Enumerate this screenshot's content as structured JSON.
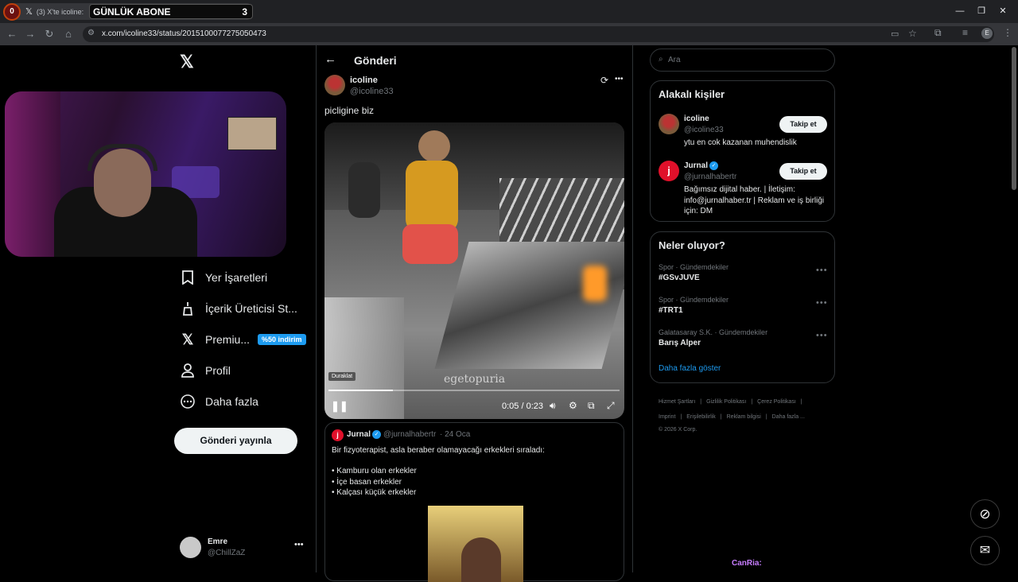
{
  "browser": {
    "tab_title": "(3) X'te icoline: \"pic",
    "overlay_counter": "0",
    "overlay_label": "GÜNLÜK ABONE",
    "overlay_count": "3",
    "url": "x.com/icoline33/status/2015100077275050473",
    "profile_initial": "E"
  },
  "sidebar": {
    "items": [
      {
        "label": "Yer İşaretleri"
      },
      {
        "label": "İçerik Üreticisi St..."
      },
      {
        "label": "Premiu...",
        "badge": "%50 indirim"
      },
      {
        "label": "Profil"
      },
      {
        "label": "Daha fazla"
      }
    ],
    "post_button": "Gönderi yayınla",
    "account": {
      "name": "Emre",
      "handle": "@ChillZaZ"
    }
  },
  "post": {
    "header_title": "Gönderi",
    "author_name": "icoline",
    "author_handle": "@icoline33",
    "text": "picligine biz",
    "video": {
      "watermark": "egetopuria",
      "paused_label": "Duraklat",
      "time": "0:05 / 0:23",
      "progress": 0.22
    },
    "quote": {
      "author_name": "Jurnal",
      "author_handle": "@jurnalhabertr",
      "date": "· 24 Oca",
      "lines": [
        "Bir fizyoterapist, asla beraber olamayacağı erkekleri sıraladı:",
        "",
        "• Kamburu olan erkekler",
        "• İçe basan erkekler",
        "• Kalçası küçük erkekler"
      ]
    }
  },
  "right": {
    "search_placeholder": "Ara",
    "related_title": "Alakalı kişiler",
    "related": [
      {
        "name": "icoline",
        "handle": "@icoline33",
        "bio": "ytu en cok kazanan muhendislik",
        "follow": "Takip et"
      },
      {
        "name": "Jurnal",
        "handle": "@jurnalhabertr",
        "bio_lines": [
          "Bağımsız dijital haber. | İletişim:",
          "info@jurnalhaber.tr | Reklam ve iş birliği",
          "için: DM"
        ],
        "follow": "Takip et"
      }
    ],
    "trends_title": "Neler oluyor?",
    "trends": [
      {
        "category": "Spor · Gündemdekiler",
        "title": "#GSvJUVE"
      },
      {
        "category": "Spor · Gündemdekiler",
        "title": "#TRT1"
      },
      {
        "category": "Galatasaray S.K. · Gündemdekiler",
        "title": "Barış Alper"
      }
    ],
    "show_more": "Daha fazla göster",
    "footer": {
      "row1": [
        "Hizmet Şartları",
        "|",
        "Gizlilik Politikası",
        "|",
        "Çerez Politikası",
        "|"
      ],
      "row2": [
        "Imprint",
        "|",
        "Erişilebilirlik",
        "|",
        "Reklam bilgisi",
        "|",
        "Daha fazla ..."
      ],
      "copyright": "© 2026 X Corp."
    }
  },
  "overlay_chat": {
    "name": "CanRia:"
  },
  "colors": {
    "accent": "#1d9bf0",
    "bg": "#000000",
    "border": "#2f3336"
  }
}
